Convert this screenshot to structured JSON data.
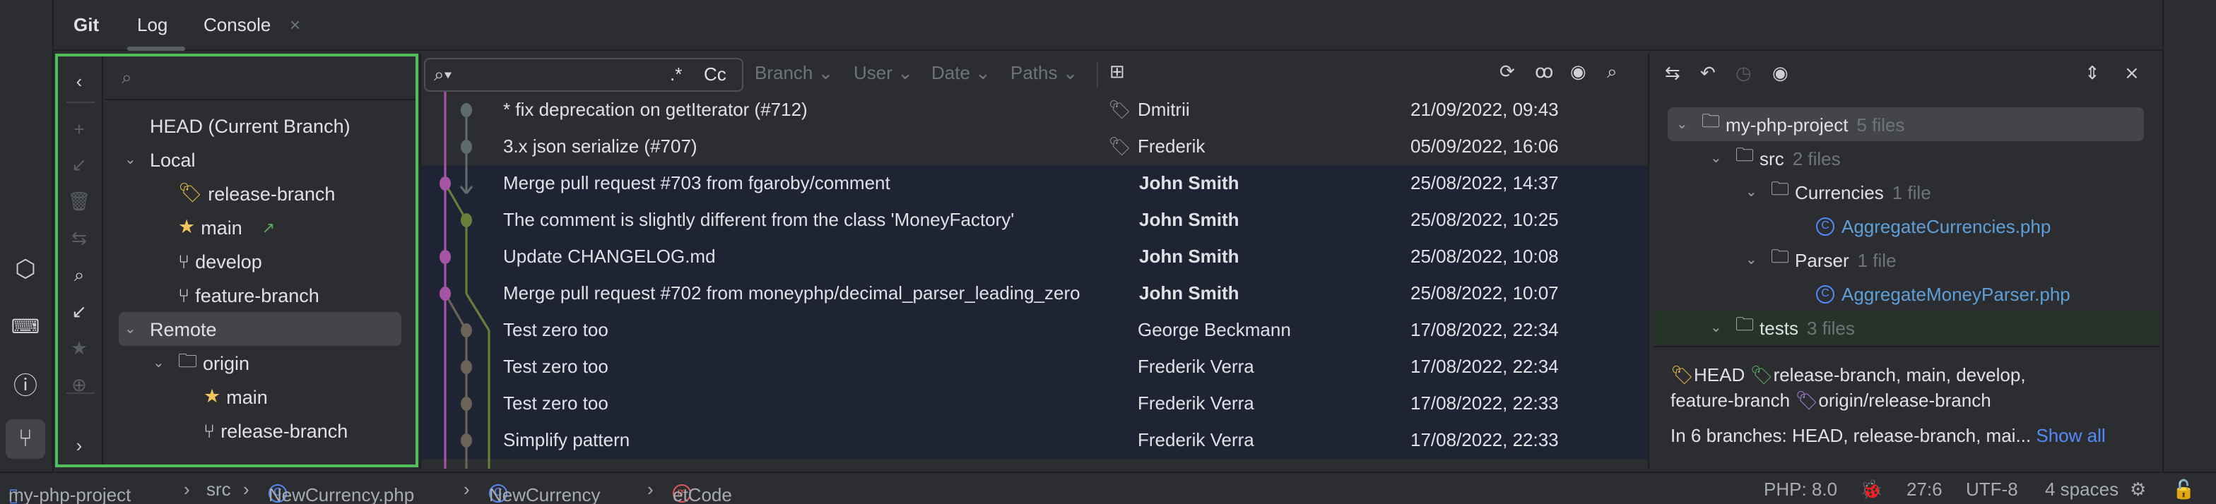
{
  "tabs": {
    "git": "Git",
    "log": "Log",
    "console": "Console",
    "close": "×"
  },
  "branches": {
    "head": "HEAD (Current Branch)",
    "local": "Local",
    "local_items": [
      "release-branch",
      "main",
      "develop",
      "feature-branch"
    ],
    "remote": "Remote",
    "origin": "origin",
    "remote_items": [
      "main",
      "release-branch"
    ]
  },
  "log_toolbar": {
    "search_placeholder": "",
    "regex": ".*",
    "case": "Cc",
    "filters": [
      "Branch",
      "User",
      "Date",
      "Paths"
    ]
  },
  "commits": [
    {
      "msg": "* fix deprecation on getIterator (#712)",
      "author": "Dmitrii",
      "date": "21/09/2022, 09:43",
      "bold": false,
      "tag": true,
      "lane": 1,
      "color": "#5f6b6b"
    },
    {
      "msg": "3.x json serialize (#707)",
      "author": "Frederik",
      "date": "05/09/2022, 16:06",
      "bold": false,
      "tag": true,
      "lane": 1,
      "color": "#5f6b6b"
    },
    {
      "msg": "Merge pull request #703 from fgaroby/comment",
      "author": "John Smith",
      "date": "25/08/2022, 14:37",
      "bold": true,
      "lane": 0,
      "color": "#a653a6"
    },
    {
      "msg": "The comment is slightly different from the class 'MoneyFactory'",
      "author": "John Smith",
      "date": "25/08/2022, 10:25",
      "bold": true,
      "lane": 1,
      "color": "#6b7d3a"
    },
    {
      "msg": "Update CHANGELOG.md",
      "author": "John Smith",
      "date": "25/08/2022, 10:08",
      "bold": true,
      "lane": 0,
      "color": "#a653a6"
    },
    {
      "msg": "Merge pull request #702 from moneyphp/decimal_parser_leading_zero",
      "author": "John Smith",
      "date": "25/08/2022, 10:07",
      "bold": true,
      "lane": 0,
      "color": "#a653a6"
    },
    {
      "msg": "Test zero too",
      "author": "George Beckmann",
      "date": "17/08/2022, 22:34",
      "bold": false,
      "lane": 1,
      "color": "#6b6356"
    },
    {
      "msg": "Test zero too",
      "author": "Frederik Verra",
      "date": "17/08/2022, 22:34",
      "bold": false,
      "lane": 1,
      "color": "#6b6356"
    },
    {
      "msg": "Test zero too",
      "author": "Frederik Verra",
      "date": "17/08/2022, 22:33",
      "bold": false,
      "lane": 1,
      "color": "#6b6356"
    },
    {
      "msg": "Simplify pattern",
      "author": "Frederik Verra",
      "date": "17/08/2022, 22:33",
      "bold": false,
      "lane": 1,
      "color": "#6b6356"
    }
  ],
  "files": {
    "root": "my-php-project",
    "root_count": "5 files",
    "src": "src",
    "src_count": "2 files",
    "currencies": "Currencies",
    "currencies_count": "1 file",
    "file1": "AggregateCurrencies.php",
    "parser": "Parser",
    "parser_count": "1 file",
    "file2": "AggregateMoneyParser.php",
    "tests": "tests",
    "tests_count": "3 files"
  },
  "details": {
    "head": "HEAD",
    "local_refs": "release-branch, main, develop,",
    "local_refs2": "feature-branch",
    "remote_ref": "origin/release-branch",
    "branches_text": "In 6 branches: HEAD, release-branch, mai...",
    "show_all": "Show all"
  },
  "status": {
    "crumbs": [
      "my-php-project",
      "src",
      "NewCurrency.php",
      "NewCurrency",
      "etCode"
    ],
    "php": "PHP: 8.0",
    "pos": "27:6",
    "enc": "UTF-8",
    "indent": "4 spaces"
  },
  "colors": {
    "accent": "#548af7",
    "highlight": "#4fbf5b",
    "selected": "#1f2435",
    "purple": "#a653a6",
    "olive": "#6b7d3a"
  }
}
